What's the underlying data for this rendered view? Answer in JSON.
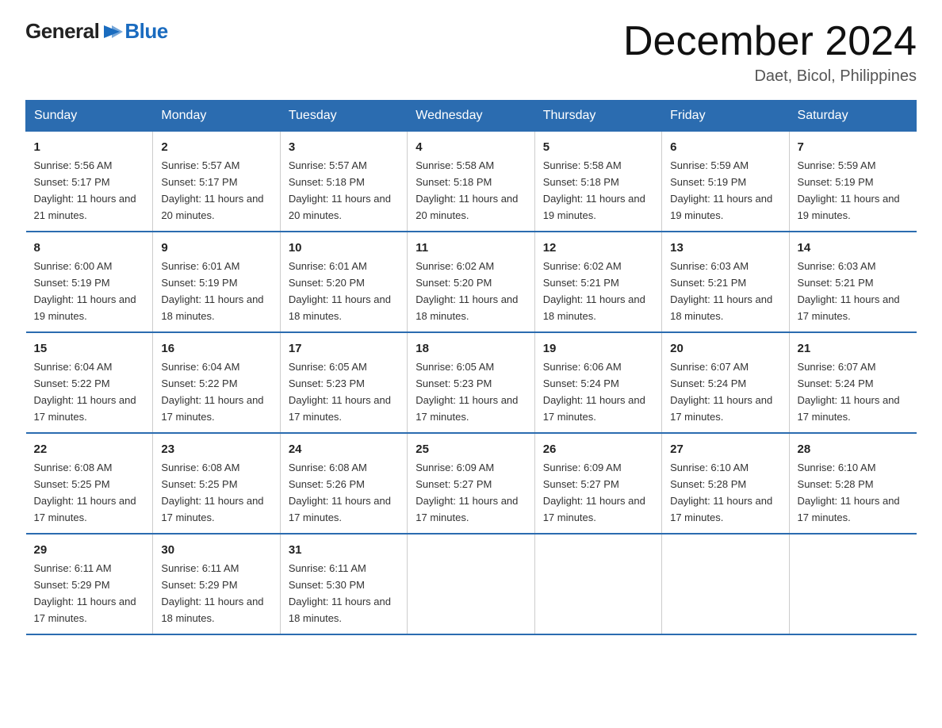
{
  "logo": {
    "general": "General",
    "blue": "Blue"
  },
  "title": "December 2024",
  "subtitle": "Daet, Bicol, Philippines",
  "weekdays": [
    "Sunday",
    "Monday",
    "Tuesday",
    "Wednesday",
    "Thursday",
    "Friday",
    "Saturday"
  ],
  "weeks": [
    [
      {
        "day": "1",
        "sunrise": "5:56 AM",
        "sunset": "5:17 PM",
        "daylight": "11 hours and 21 minutes."
      },
      {
        "day": "2",
        "sunrise": "5:57 AM",
        "sunset": "5:17 PM",
        "daylight": "11 hours and 20 minutes."
      },
      {
        "day": "3",
        "sunrise": "5:57 AM",
        "sunset": "5:18 PM",
        "daylight": "11 hours and 20 minutes."
      },
      {
        "day": "4",
        "sunrise": "5:58 AM",
        "sunset": "5:18 PM",
        "daylight": "11 hours and 20 minutes."
      },
      {
        "day": "5",
        "sunrise": "5:58 AM",
        "sunset": "5:18 PM",
        "daylight": "11 hours and 19 minutes."
      },
      {
        "day": "6",
        "sunrise": "5:59 AM",
        "sunset": "5:19 PM",
        "daylight": "11 hours and 19 minutes."
      },
      {
        "day": "7",
        "sunrise": "5:59 AM",
        "sunset": "5:19 PM",
        "daylight": "11 hours and 19 minutes."
      }
    ],
    [
      {
        "day": "8",
        "sunrise": "6:00 AM",
        "sunset": "5:19 PM",
        "daylight": "11 hours and 19 minutes."
      },
      {
        "day": "9",
        "sunrise": "6:01 AM",
        "sunset": "5:19 PM",
        "daylight": "11 hours and 18 minutes."
      },
      {
        "day": "10",
        "sunrise": "6:01 AM",
        "sunset": "5:20 PM",
        "daylight": "11 hours and 18 minutes."
      },
      {
        "day": "11",
        "sunrise": "6:02 AM",
        "sunset": "5:20 PM",
        "daylight": "11 hours and 18 minutes."
      },
      {
        "day": "12",
        "sunrise": "6:02 AM",
        "sunset": "5:21 PM",
        "daylight": "11 hours and 18 minutes."
      },
      {
        "day": "13",
        "sunrise": "6:03 AM",
        "sunset": "5:21 PM",
        "daylight": "11 hours and 18 minutes."
      },
      {
        "day": "14",
        "sunrise": "6:03 AM",
        "sunset": "5:21 PM",
        "daylight": "11 hours and 17 minutes."
      }
    ],
    [
      {
        "day": "15",
        "sunrise": "6:04 AM",
        "sunset": "5:22 PM",
        "daylight": "11 hours and 17 minutes."
      },
      {
        "day": "16",
        "sunrise": "6:04 AM",
        "sunset": "5:22 PM",
        "daylight": "11 hours and 17 minutes."
      },
      {
        "day": "17",
        "sunrise": "6:05 AM",
        "sunset": "5:23 PM",
        "daylight": "11 hours and 17 minutes."
      },
      {
        "day": "18",
        "sunrise": "6:05 AM",
        "sunset": "5:23 PM",
        "daylight": "11 hours and 17 minutes."
      },
      {
        "day": "19",
        "sunrise": "6:06 AM",
        "sunset": "5:24 PM",
        "daylight": "11 hours and 17 minutes."
      },
      {
        "day": "20",
        "sunrise": "6:07 AM",
        "sunset": "5:24 PM",
        "daylight": "11 hours and 17 minutes."
      },
      {
        "day": "21",
        "sunrise": "6:07 AM",
        "sunset": "5:24 PM",
        "daylight": "11 hours and 17 minutes."
      }
    ],
    [
      {
        "day": "22",
        "sunrise": "6:08 AM",
        "sunset": "5:25 PM",
        "daylight": "11 hours and 17 minutes."
      },
      {
        "day": "23",
        "sunrise": "6:08 AM",
        "sunset": "5:25 PM",
        "daylight": "11 hours and 17 minutes."
      },
      {
        "day": "24",
        "sunrise": "6:08 AM",
        "sunset": "5:26 PM",
        "daylight": "11 hours and 17 minutes."
      },
      {
        "day": "25",
        "sunrise": "6:09 AM",
        "sunset": "5:27 PM",
        "daylight": "11 hours and 17 minutes."
      },
      {
        "day": "26",
        "sunrise": "6:09 AM",
        "sunset": "5:27 PM",
        "daylight": "11 hours and 17 minutes."
      },
      {
        "day": "27",
        "sunrise": "6:10 AM",
        "sunset": "5:28 PM",
        "daylight": "11 hours and 17 minutes."
      },
      {
        "day": "28",
        "sunrise": "6:10 AM",
        "sunset": "5:28 PM",
        "daylight": "11 hours and 17 minutes."
      }
    ],
    [
      {
        "day": "29",
        "sunrise": "6:11 AM",
        "sunset": "5:29 PM",
        "daylight": "11 hours and 17 minutes."
      },
      {
        "day": "30",
        "sunrise": "6:11 AM",
        "sunset": "5:29 PM",
        "daylight": "11 hours and 18 minutes."
      },
      {
        "day": "31",
        "sunrise": "6:11 AM",
        "sunset": "5:30 PM",
        "daylight": "11 hours and 18 minutes."
      },
      null,
      null,
      null,
      null
    ]
  ]
}
